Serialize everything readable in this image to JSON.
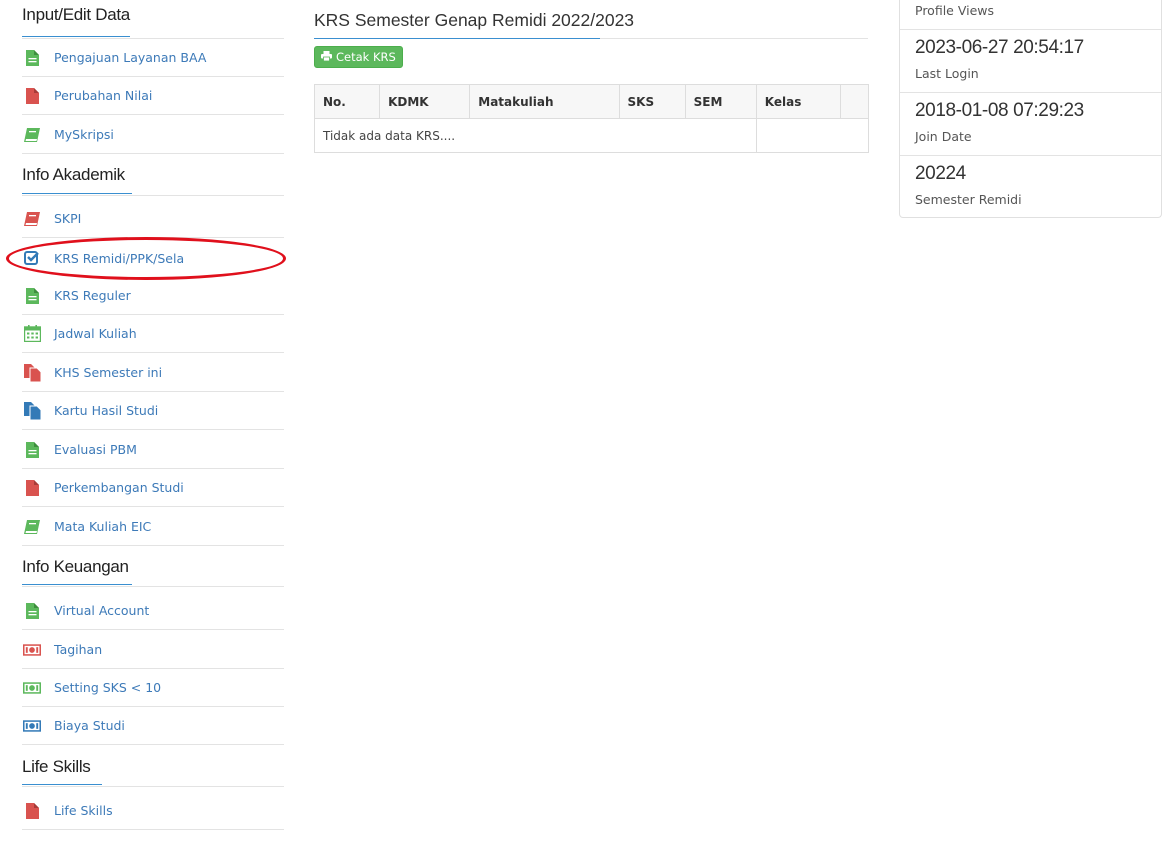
{
  "sidebar": {
    "sections": [
      {
        "title": "Input/Edit Data",
        "items": [
          {
            "label": "Pengajuan Layanan BAA",
            "icon": "file-icon",
            "color": "#5cb85c"
          },
          {
            "label": "Perubahan Nilai",
            "icon": "file-icon",
            "color": "#d9534f"
          },
          {
            "label": "MySkripsi",
            "icon": "book-icon",
            "color": "#5cb85c"
          }
        ]
      },
      {
        "title": "Info Akademik",
        "items": [
          {
            "label": "SKPI",
            "icon": "book-icon",
            "color": "#d9534f"
          },
          {
            "label": "KRS Remidi/PPK/Sela",
            "icon": "check-square-icon",
            "color": "#337ab7"
          },
          {
            "label": "KRS Reguler",
            "icon": "file-icon",
            "color": "#5cb85c"
          },
          {
            "label": "Jadwal Kuliah",
            "icon": "calendar-icon",
            "color": "#5cb85c"
          },
          {
            "label": "KHS Semester ini",
            "icon": "files-icon",
            "color": "#d9534f"
          },
          {
            "label": "Kartu Hasil Studi",
            "icon": "files-icon",
            "color": "#337ab7"
          },
          {
            "label": "Evaluasi PBM",
            "icon": "file-icon",
            "color": "#5cb85c"
          },
          {
            "label": "Perkembangan Studi",
            "icon": "file-icon",
            "color": "#d9534f"
          },
          {
            "label": "Mata Kuliah EIC",
            "icon": "book-icon",
            "color": "#5cb85c"
          }
        ]
      },
      {
        "title": "Info Keuangan",
        "items": [
          {
            "label": "Virtual Account",
            "icon": "file-icon",
            "color": "#5cb85c"
          },
          {
            "label": "Tagihan",
            "icon": "money-icon",
            "color": "#d9534f"
          },
          {
            "label": "Setting SKS < 10",
            "icon": "money-icon",
            "color": "#5cb85c"
          },
          {
            "label": "Biaya Studi",
            "icon": "money-icon",
            "color": "#337ab7"
          }
        ]
      },
      {
        "title": "Life Skills",
        "items": [
          {
            "label": "Life Skills",
            "icon": "file-icon",
            "color": "#d9534f"
          }
        ]
      }
    ]
  },
  "main": {
    "title": "KRS Semester Genap Remidi 2022/2023",
    "print_button": "Cetak KRS",
    "table": {
      "headers": [
        "No.",
        "KDMK",
        "Matakuliah",
        "SKS",
        "SEM",
        "Kelas",
        ""
      ],
      "empty_message": "Tidak ada data KRS...."
    }
  },
  "stats": [
    {
      "value": "",
      "label": "Profile Views"
    },
    {
      "value": "2023-06-27 20:54:17",
      "label": "Last Login"
    },
    {
      "value": "2018-01-08 07:29:23",
      "label": "Join Date"
    },
    {
      "value": "20224",
      "label": "Semester Remidi"
    }
  ]
}
